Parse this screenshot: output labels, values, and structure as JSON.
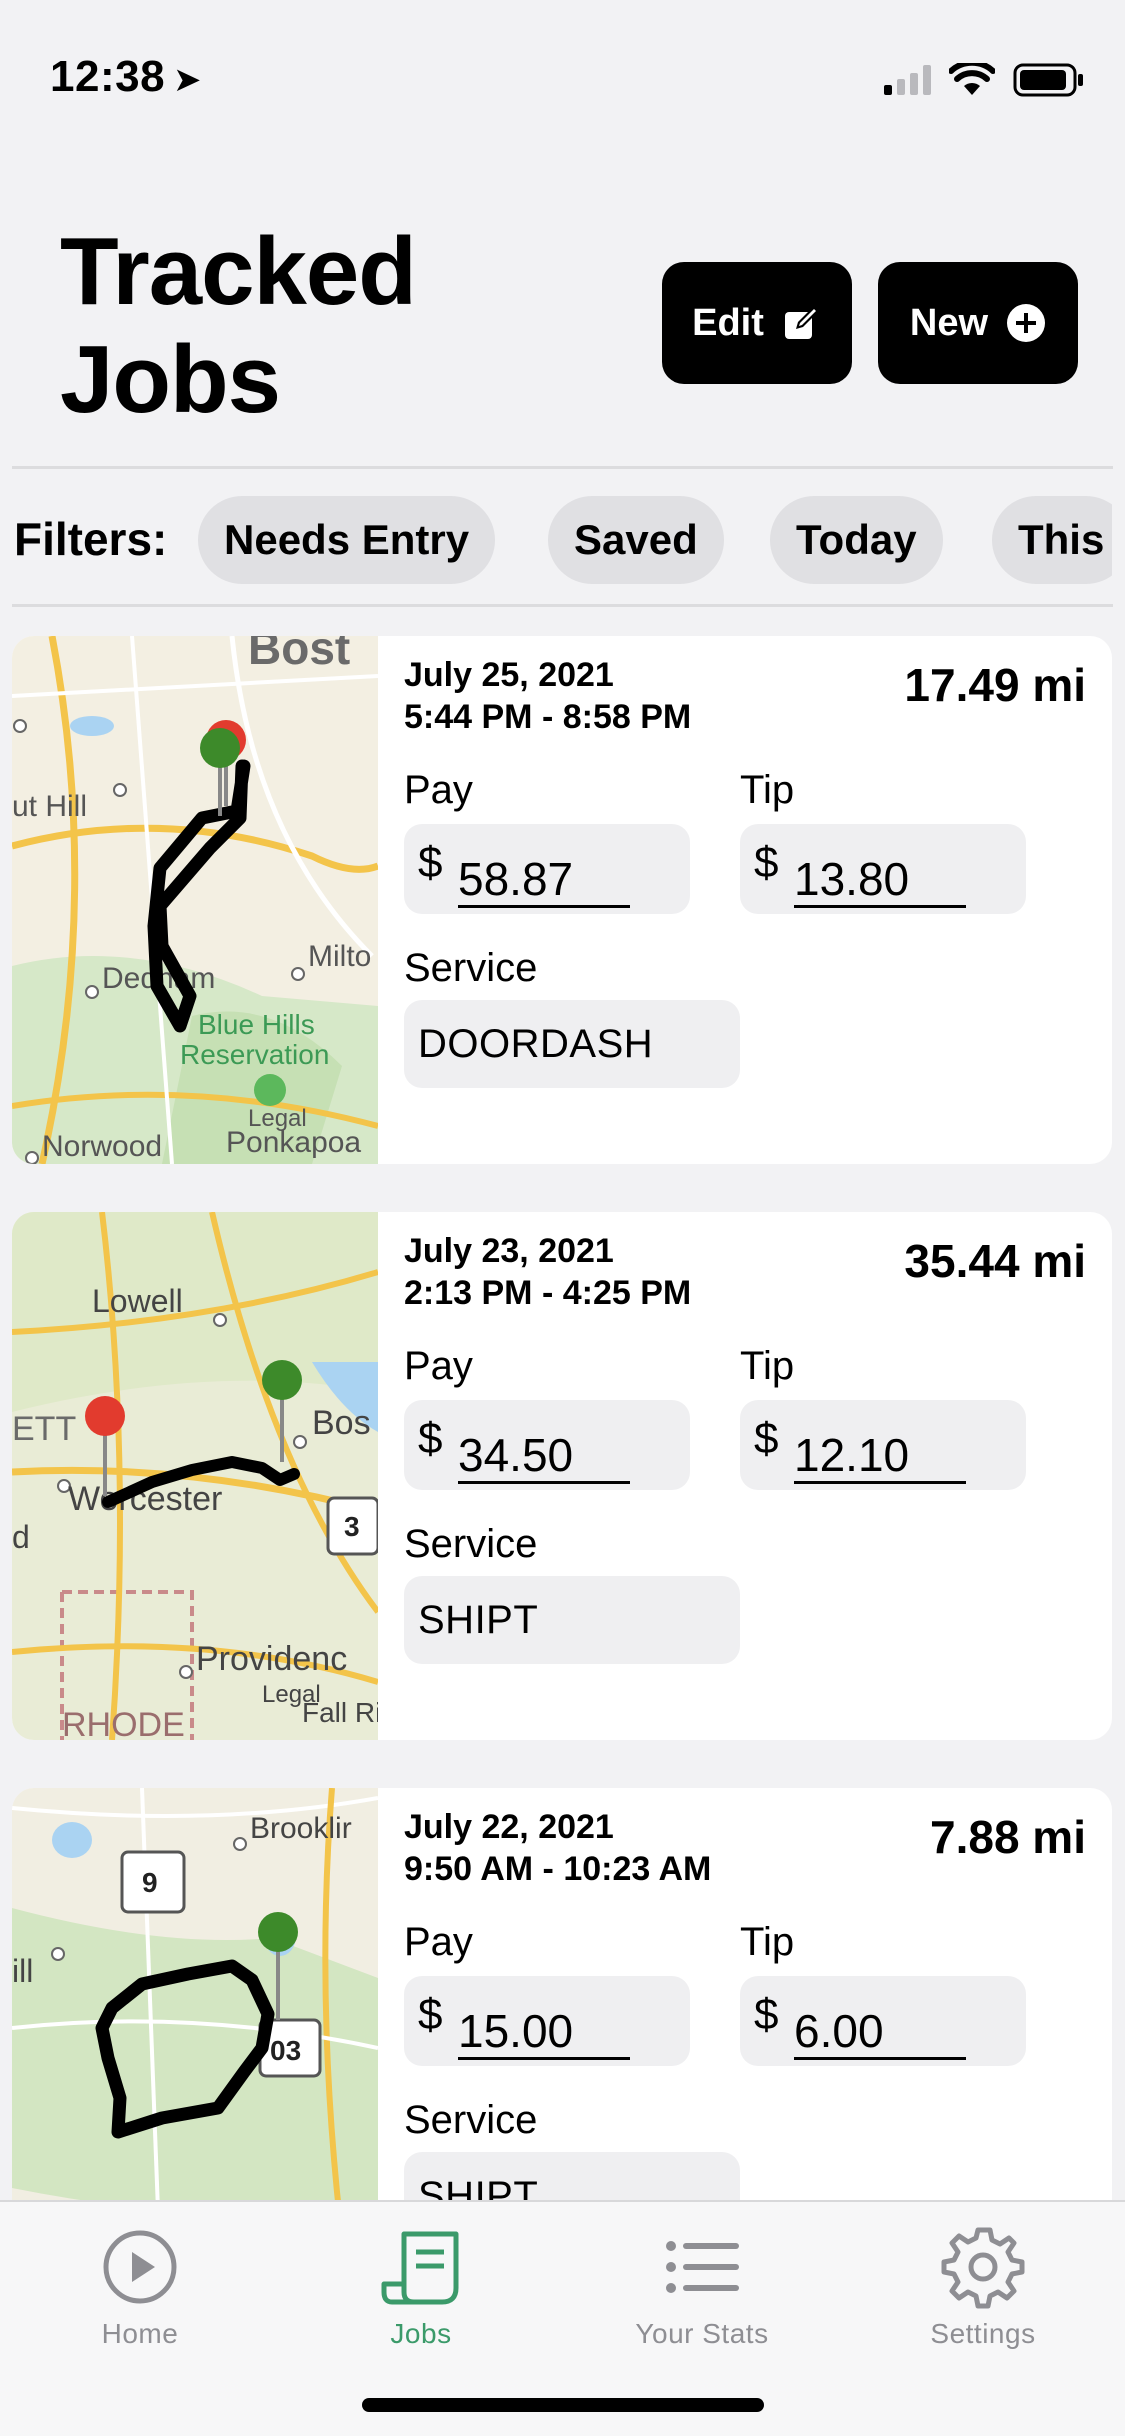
{
  "status_bar": {
    "time": "12:38"
  },
  "header": {
    "title_line1": "Tracked",
    "title_line2": "Jobs",
    "edit_label": "Edit",
    "new_label": "New"
  },
  "filters": {
    "label": "Filters:",
    "chips": [
      "Needs Entry",
      "Saved",
      "Today",
      "This"
    ]
  },
  "jobs": [
    {
      "date": "July 25, 2021",
      "time_range": "5:44 PM - 8:58 PM",
      "distance": "17.49 mi",
      "pay_label": "Pay",
      "pay_currency": "$",
      "pay": "58.87",
      "tip_label": "Tip",
      "tip_currency": "$",
      "tip": "13.80",
      "service_label": "Service",
      "service": "DOORDASH",
      "map_labels": [
        "Bost",
        "ut Hill",
        "Dedham",
        "Milto",
        "Blue Hills",
        "Reservation",
        "Legal",
        "Norwood",
        "Ponkapoa"
      ]
    },
    {
      "date": "July 23, 2021",
      "time_range": "2:13 PM - 4:25 PM",
      "distance": "35.44 mi",
      "pay_label": "Pay",
      "pay_currency": "$",
      "pay": "34.50",
      "tip_label": "Tip",
      "tip_currency": "$",
      "tip": "12.10",
      "service_label": "Service",
      "service": "SHIPT",
      "map_labels": [
        "Lowell",
        "ETT",
        "Bos",
        "Worcester",
        "d",
        "3",
        "Providenc",
        "Legal",
        "Fall Riv",
        "RHODE"
      ]
    },
    {
      "date": "July 22, 2021",
      "time_range": "9:50 AM - 10:23 AM",
      "distance": "7.88 mi",
      "pay_label": "Pay",
      "pay_currency": "$",
      "pay": "15.00",
      "tip_label": "Tip",
      "tip_currency": "$",
      "tip": "6.00",
      "service_label": "Service",
      "service": "SHIPT",
      "map_labels": [
        "Brooklir",
        "9",
        "ill",
        "03"
      ]
    }
  ],
  "tab_bar": {
    "tabs": [
      {
        "label": "Home",
        "icon": "play-circle-icon"
      },
      {
        "label": "Jobs",
        "icon": "receipt-icon"
      },
      {
        "label": "Your Stats",
        "icon": "list-icon"
      },
      {
        "label": "Settings",
        "icon": "gear-icon"
      }
    ],
    "active": "Jobs"
  },
  "colors": {
    "accent": "#3b9a6a",
    "button_bg": "#000000",
    "chip_bg": "#e0e0e3",
    "inactive_tab": "#8e8e93"
  }
}
